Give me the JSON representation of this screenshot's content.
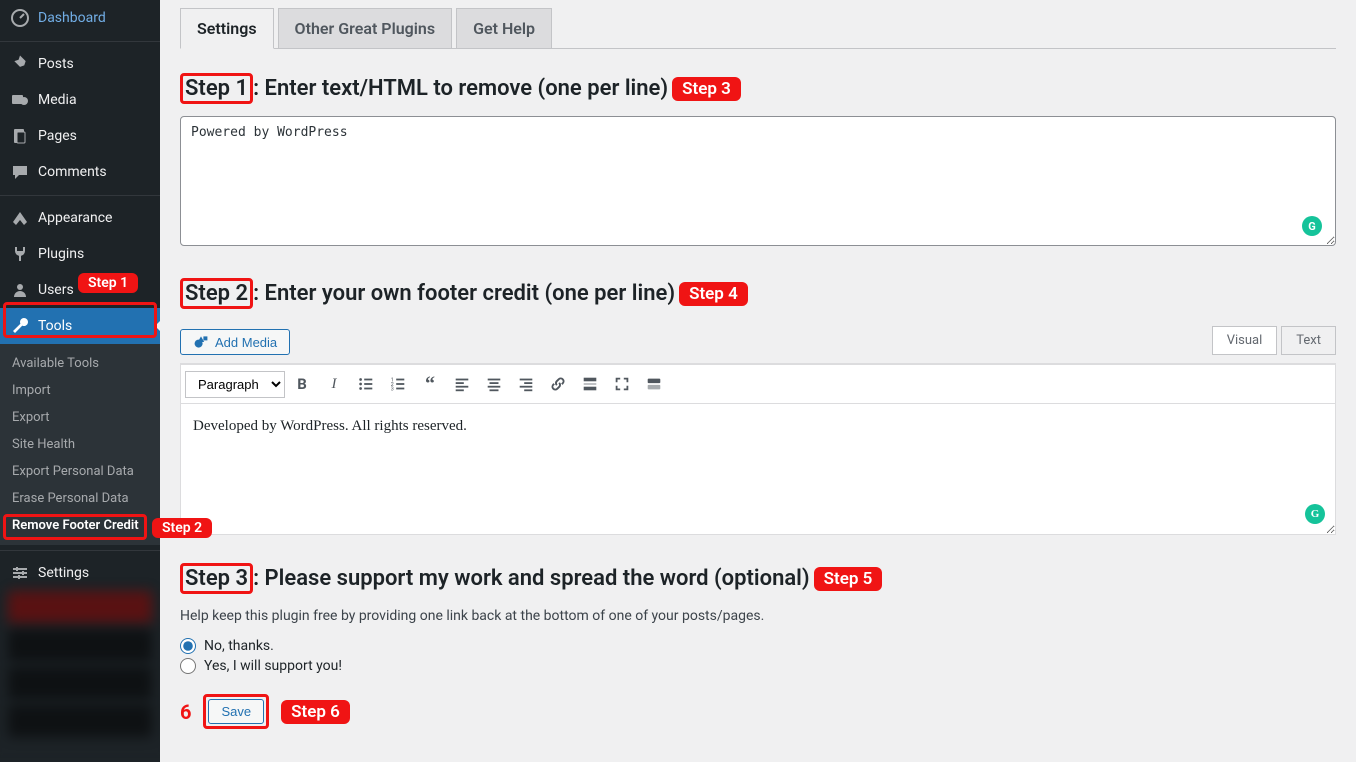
{
  "sidebar": {
    "items": [
      {
        "label": "Dashboard",
        "icon": "dashboard"
      },
      {
        "label": "Posts",
        "icon": "pin"
      },
      {
        "label": "Media",
        "icon": "media"
      },
      {
        "label": "Pages",
        "icon": "pages"
      },
      {
        "label": "Comments",
        "icon": "comments"
      },
      {
        "label": "Appearance",
        "icon": "appearance"
      },
      {
        "label": "Plugins",
        "icon": "plugin"
      },
      {
        "label": "Users",
        "icon": "users"
      },
      {
        "label": "Tools",
        "icon": "tools"
      },
      {
        "label": "Settings",
        "icon": "settings"
      }
    ],
    "submenu": {
      "items": [
        {
          "label": "Available Tools"
        },
        {
          "label": "Import"
        },
        {
          "label": "Export"
        },
        {
          "label": "Site Health"
        },
        {
          "label": "Export Personal Data"
        },
        {
          "label": "Erase Personal Data"
        },
        {
          "label": "Remove Footer Credit"
        }
      ]
    },
    "badges": {
      "step1": "Step 1",
      "step2": "Step 2"
    }
  },
  "tabs": {
    "settings": "Settings",
    "other": "Other Great Plugins",
    "help": "Get Help"
  },
  "section1": {
    "step_left": "Step 1",
    "title": ": Enter text/HTML to remove (one per line)",
    "step_right": "Step 3",
    "textarea_value": "Powered by WordPress"
  },
  "section2": {
    "step_left": "Step 2",
    "title": ": Enter your own footer credit (one per line)",
    "step_right": "Step 4",
    "add_media": "Add Media",
    "visual_tab": "Visual",
    "text_tab": "Text",
    "format_select": "Paragraph",
    "content": "Developed by WordPress. All rights reserved."
  },
  "section3": {
    "step_left": "Step 3",
    "title": ": Please support my work and spread the word (optional)",
    "step_right": "Step 5",
    "help": "Help keep this plugin free by providing one link back at the bottom of one of your posts/pages.",
    "opt_no": "No, thanks.",
    "opt_yes": "Yes, I will support you!"
  },
  "save": {
    "num": "6",
    "label": "Save",
    "badge": "Step 6"
  },
  "grammarly_glyph": "G"
}
